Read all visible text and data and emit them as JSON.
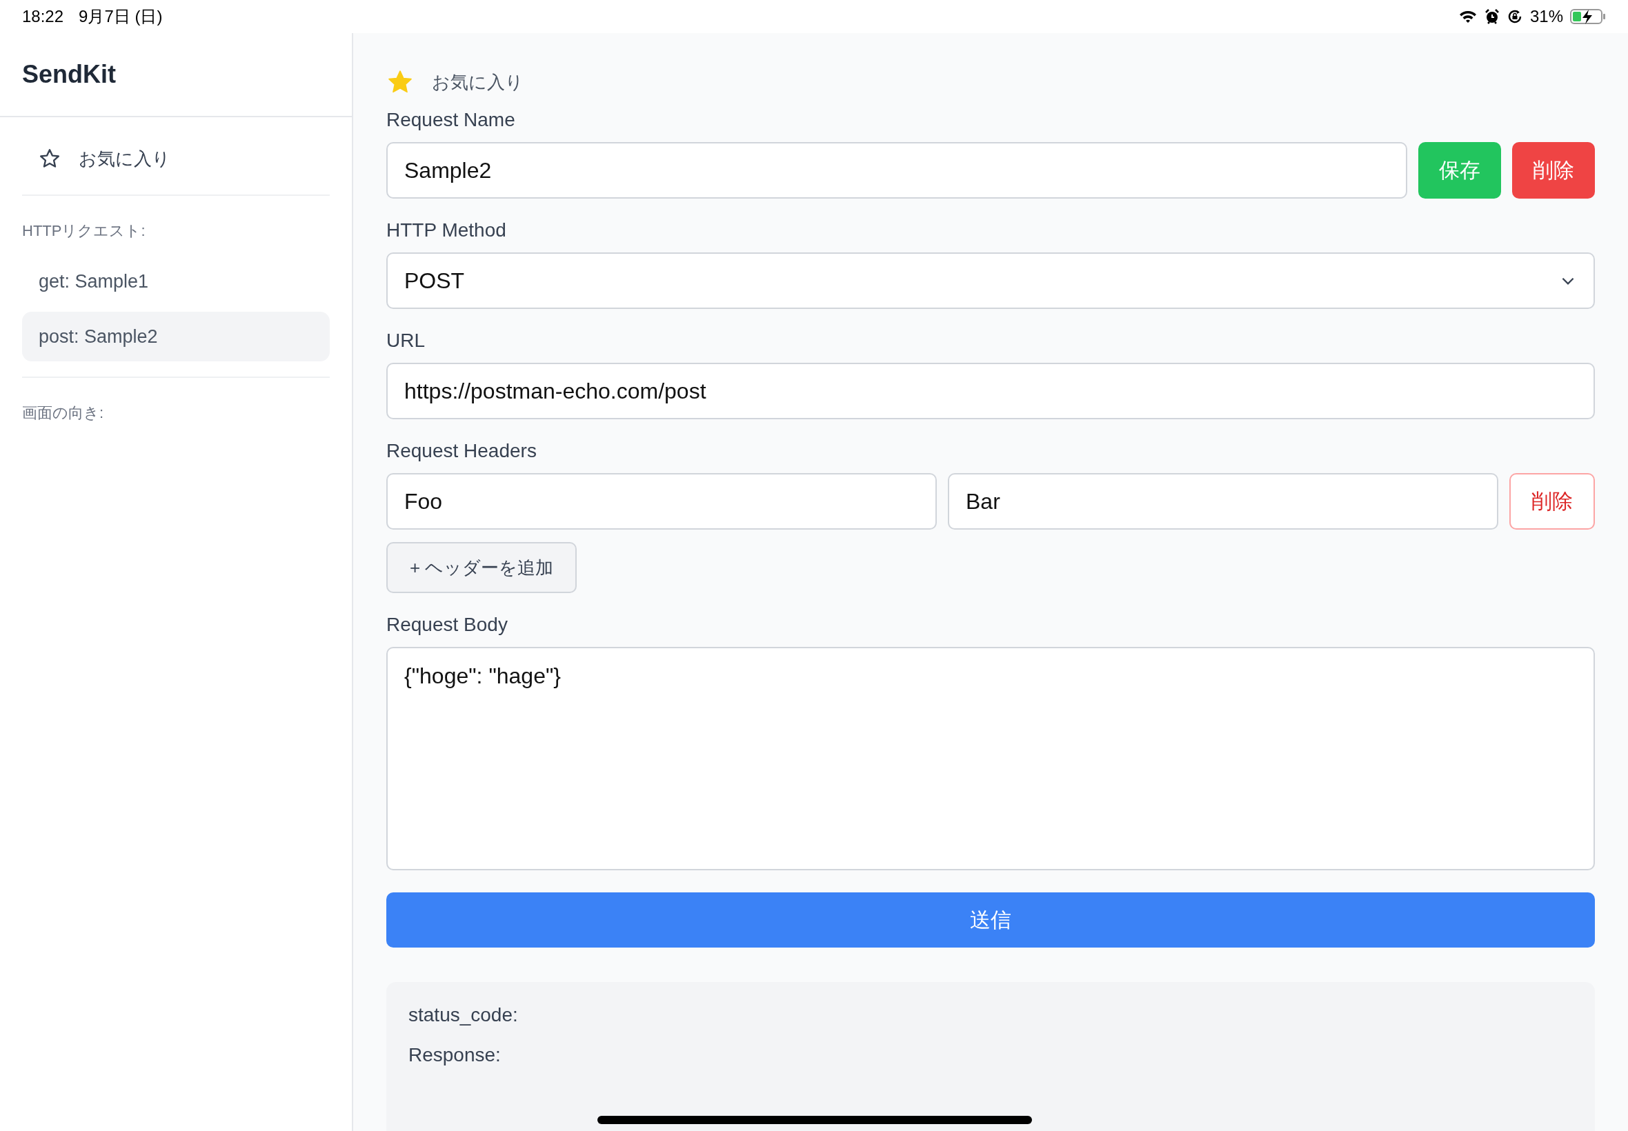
{
  "status_bar": {
    "time": "18:22",
    "date": "9月7日 (日)",
    "battery": "31%"
  },
  "sidebar": {
    "title": "SendKit",
    "favorites": {
      "label": "お気に入り"
    },
    "section_label": "HTTPリクエスト:",
    "requests": [
      {
        "label": "get: Sample1",
        "selected": false
      },
      {
        "label": "post: Sample2",
        "selected": true
      }
    ],
    "orientation_label": "画面の向き:"
  },
  "main": {
    "favorite": {
      "label": "お気に入り",
      "starred": true
    },
    "request_name": {
      "label": "Request Name",
      "value": "Sample2"
    },
    "save_button": "保存",
    "delete_button": "削除",
    "method": {
      "label": "HTTP Method",
      "value": "POST"
    },
    "url": {
      "label": "URL",
      "value": "https://postman-echo.com/post"
    },
    "headers": {
      "label": "Request Headers",
      "rows": [
        {
          "key": "Foo",
          "value": "Bar",
          "delete": "削除"
        }
      ],
      "add_button": "+ ヘッダーを追加"
    },
    "body": {
      "label": "Request Body",
      "value": "{\"hoge\": \"hage\"}"
    },
    "send_button": "送信",
    "response": {
      "status_label": "status_code:",
      "response_label": "Response:"
    }
  }
}
